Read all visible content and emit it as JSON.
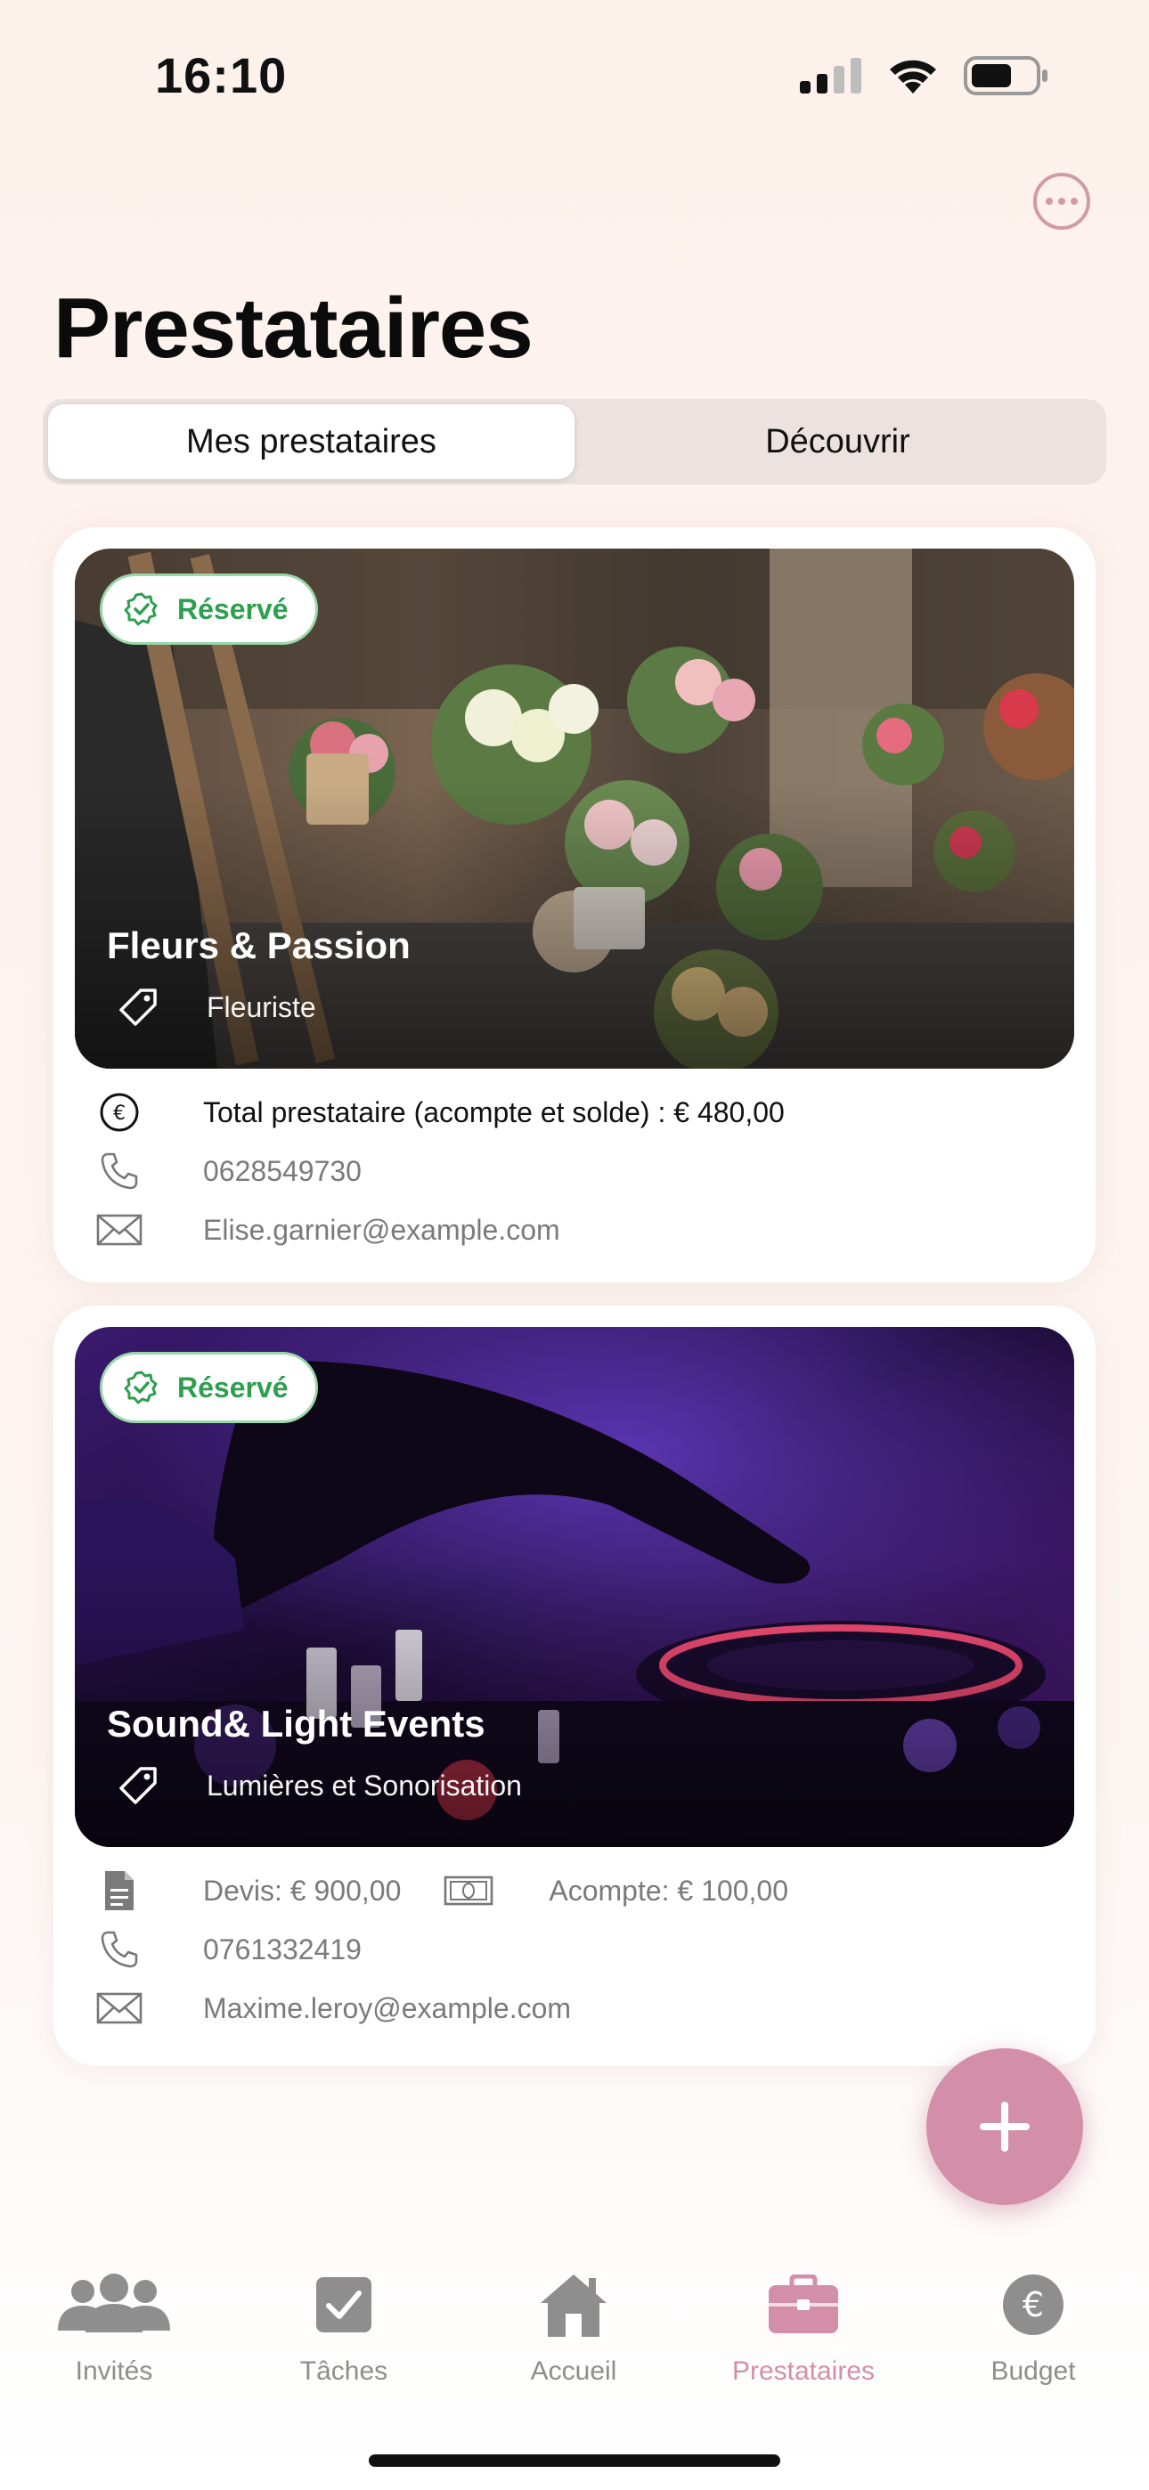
{
  "status_bar": {
    "time": "16:10"
  },
  "page": {
    "title": "Prestataires"
  },
  "segments": [
    {
      "label": "Mes prestataires",
      "active": true
    },
    {
      "label": "Découvrir",
      "active": false
    }
  ],
  "vendors": [
    {
      "badge": "Réservé",
      "name": "Fleurs & Passion",
      "category": "Fleuriste",
      "total": "Total prestataire (acompte et solde) : € 480,00",
      "phone": "0628549730",
      "email": "Elise.garnier@example.com"
    },
    {
      "badge": "Réservé",
      "name": "Sound& Light Events",
      "category": "Lumières et Sonorisation",
      "quote": "Devis: € 900,00",
      "deposit": "Acompte: € 100,00",
      "phone": "0761332419",
      "email": "Maxime.leroy@example.com"
    }
  ],
  "tabs": [
    {
      "label": "Invités",
      "icon": "people-icon",
      "active": false
    },
    {
      "label": "Tâches",
      "icon": "checkbox-icon",
      "active": false
    },
    {
      "label": "Accueil",
      "icon": "house-icon",
      "active": false
    },
    {
      "label": "Prestataires",
      "icon": "briefcase-icon",
      "active": true
    },
    {
      "label": "Budget",
      "icon": "euro-icon",
      "active": false
    }
  ],
  "colors": {
    "accent": "#d38fa9",
    "reserved_green": "#2e9e4f",
    "inactive_tab": "#8e8e8e"
  }
}
